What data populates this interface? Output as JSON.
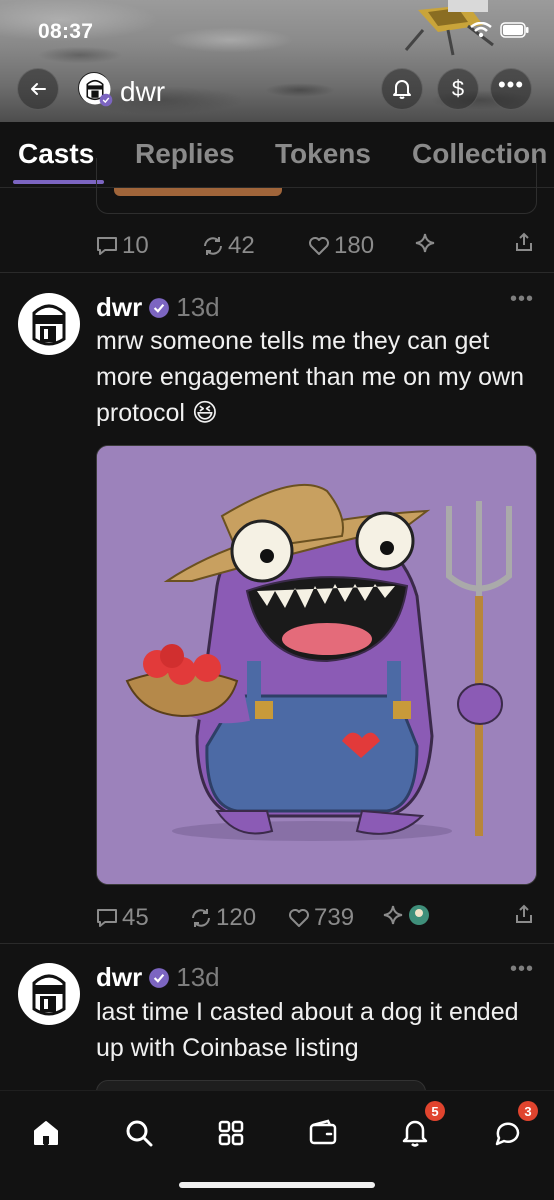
{
  "status_bar": {
    "time": "08:37"
  },
  "header": {
    "profile_name": "dwr"
  },
  "tabs": [
    {
      "label": "Casts",
      "active": true
    },
    {
      "label": "Replies",
      "active": false
    },
    {
      "label": "Tokens",
      "active": false
    },
    {
      "label": "Collection",
      "active": false
    }
  ],
  "prev_post": {
    "actions": {
      "replies": "10",
      "recasts": "42",
      "likes": "180"
    }
  },
  "posts": [
    {
      "author": "dwr",
      "time": "13d",
      "text": "mrw someone tells me they can get more engagement than me on my own protocol 😆",
      "actions": {
        "replies": "45",
        "recasts": "120",
        "likes": "739"
      }
    },
    {
      "author": "dwr",
      "time": "13d",
      "text": "last time I casted about a dog it ended up with Coinbase listing"
    }
  ],
  "bottom_nav": {
    "items": [
      "home-icon",
      "search-icon",
      "apps-icon",
      "wallet-icon",
      "notifications-icon",
      "messages-icon"
    ],
    "notifications_badge": "5",
    "messages_badge": "3"
  },
  "colors": {
    "accent": "#7c65c1",
    "background": "#121212",
    "badge": "#e0442e",
    "image_bg": "#9c82bb"
  }
}
